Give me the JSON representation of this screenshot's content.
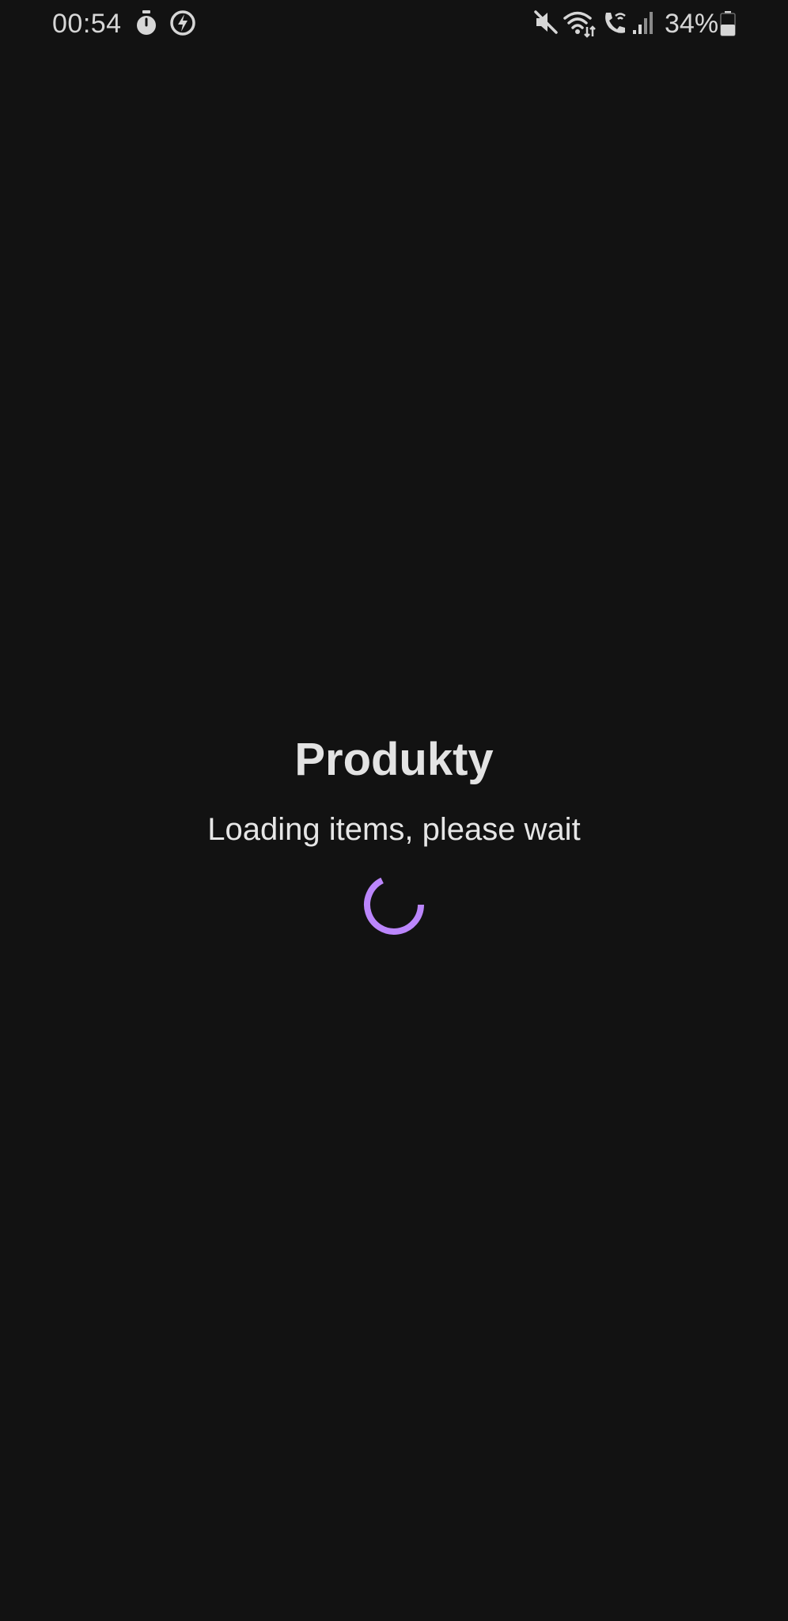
{
  "status_bar": {
    "time": "00:54",
    "battery_percent": "34%",
    "battery_level": 0.34,
    "left_icons": [
      "stopwatch-icon",
      "power-saving-icon"
    ],
    "right_icons": [
      "mute-icon",
      "wifi-icon",
      "wifi-calling-icon",
      "signal-icon",
      "battery-icon"
    ]
  },
  "main": {
    "title": "Produkty",
    "message": "Loading items, please wait",
    "spinner_color": "#bb86fc"
  },
  "colors": {
    "background": "#121212",
    "text": "#e3e3e3",
    "accent": "#bb86fc"
  }
}
